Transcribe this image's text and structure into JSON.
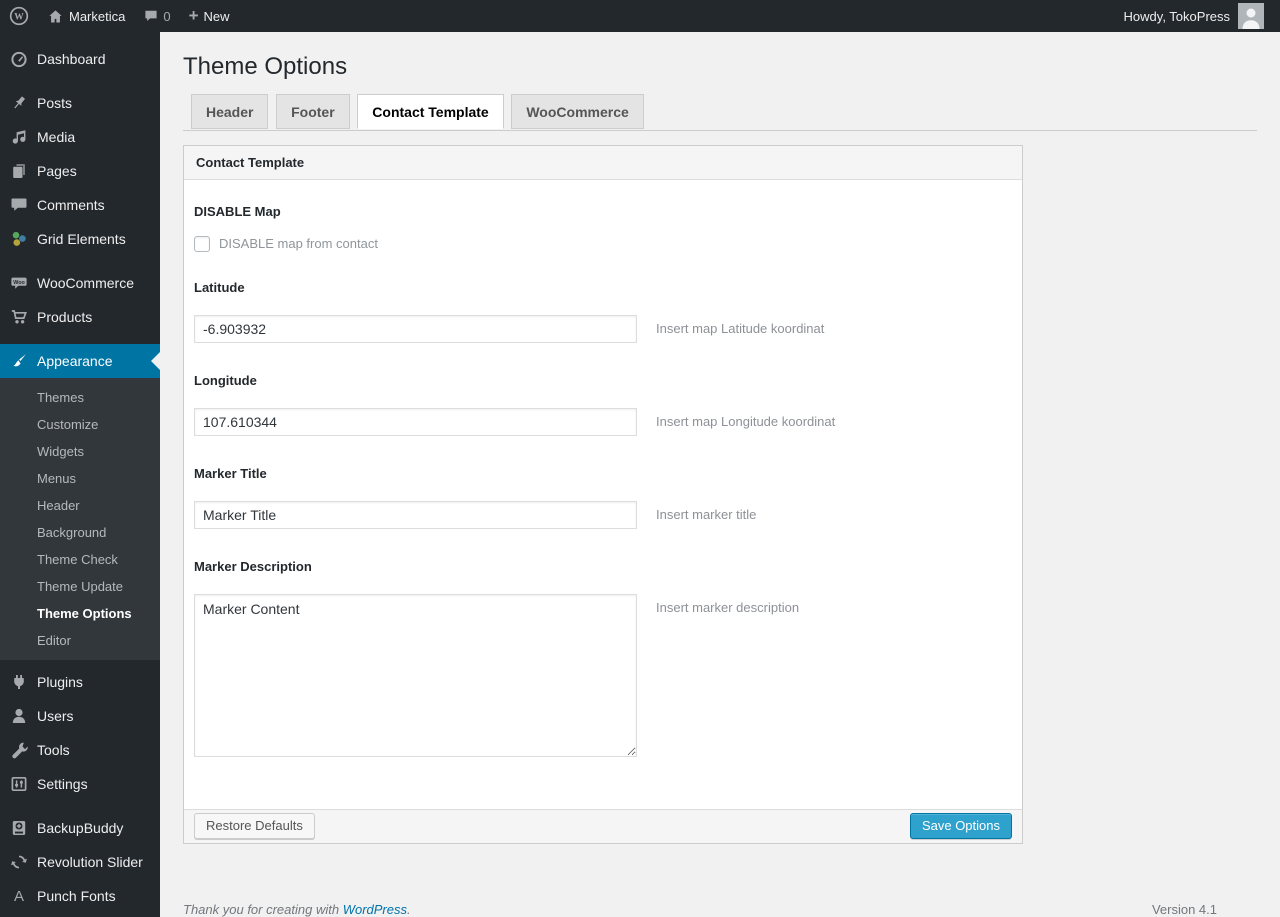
{
  "admin_bar": {
    "logo_letter": "W",
    "site_name": "Marketica",
    "comment_count": "0",
    "new_label": "New",
    "howdy": "Howdy, TokoPress"
  },
  "sidebar": {
    "items": [
      {
        "label": "Dashboard",
        "icon": "dashboard-icon"
      },
      {
        "label": "Posts",
        "icon": "pushpin-icon"
      },
      {
        "label": "Media",
        "icon": "media-icon"
      },
      {
        "label": "Pages",
        "icon": "pages-icon"
      },
      {
        "label": "Comments",
        "icon": "comments-icon"
      },
      {
        "label": "Grid Elements",
        "icon": "grid-elements-icon"
      },
      {
        "label": "WooCommerce",
        "icon": "woocommerce-icon"
      },
      {
        "label": "Products",
        "icon": "cart-icon"
      },
      {
        "label": "Appearance",
        "icon": "brush-icon",
        "active": true
      },
      {
        "label": "Plugins",
        "icon": "plugin-icon"
      },
      {
        "label": "Users",
        "icon": "user-icon"
      },
      {
        "label": "Tools",
        "icon": "wrench-icon"
      },
      {
        "label": "Settings",
        "icon": "settings-icon"
      },
      {
        "label": "BackupBuddy",
        "icon": "backup-disk-icon"
      },
      {
        "label": "Revolution Slider",
        "icon": "cycle-arrows-icon"
      },
      {
        "label": "Punch Fonts",
        "icon": "letter-a-icon"
      }
    ],
    "appearance_submenu": [
      {
        "label": "Themes"
      },
      {
        "label": "Customize"
      },
      {
        "label": "Widgets"
      },
      {
        "label": "Menus"
      },
      {
        "label": "Header"
      },
      {
        "label": "Background"
      },
      {
        "label": "Theme Check"
      },
      {
        "label": "Theme Update"
      },
      {
        "label": "Theme Options",
        "current": true
      },
      {
        "label": "Editor"
      }
    ]
  },
  "main": {
    "page_title": "Theme Options",
    "tabs": [
      {
        "label": "Header"
      },
      {
        "label": "Footer"
      },
      {
        "label": "Contact Template",
        "active": true
      },
      {
        "label": "WooCommerce"
      }
    ],
    "panel": {
      "title": "Contact Template",
      "fields": {
        "disable_map": {
          "label": "DISABLE Map",
          "checkbox_label": "DISABLE map from contact",
          "checked": false
        },
        "latitude": {
          "label": "Latitude",
          "value": "-6.903932",
          "hint": "Insert map Latitude koordinat"
        },
        "longitude": {
          "label": "Longitude",
          "value": "107.610344",
          "hint": "Insert map Longitude koordinat"
        },
        "marker_title": {
          "label": "Marker Title",
          "value": "Marker Title",
          "hint": "Insert marker title"
        },
        "marker_description": {
          "label": "Marker Description",
          "value": "Marker Content",
          "hint": "Insert marker description"
        }
      },
      "restore_button": "Restore Defaults",
      "save_button": "Save Options"
    }
  },
  "footer": {
    "thanks_prefix": "Thank you for creating with ",
    "wordpress_link": "WordPress",
    "thanks_suffix": ".",
    "version": "Version 4.1"
  },
  "colors": {
    "menu_highlight": "#0074a2",
    "button_primary": "#2ea2cc",
    "link_blue": "#0073aa",
    "admin_bar_bg": "#23282d",
    "submenu_bg": "#32373c",
    "page_bg": "#f1f1f1"
  }
}
